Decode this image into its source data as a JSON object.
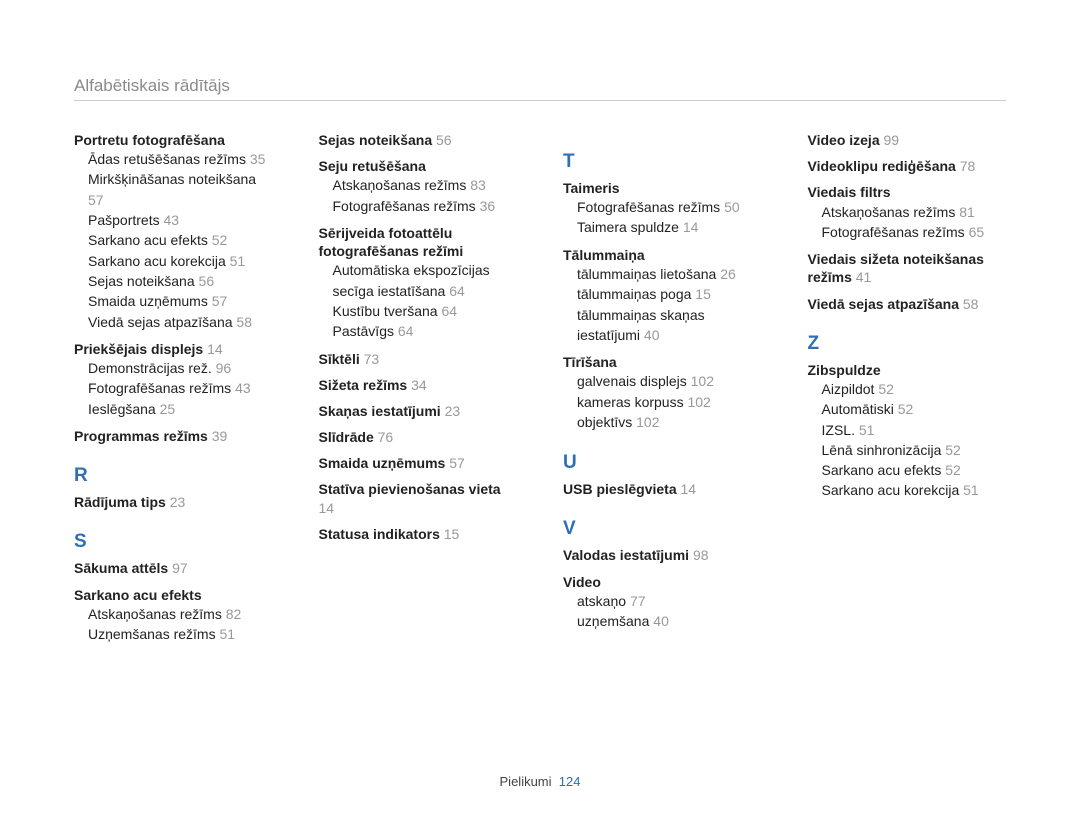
{
  "header": "Alfabētiskais rādītājs",
  "footer": {
    "label": "Pielikumi",
    "page": "124"
  },
  "columns": [
    [
      {
        "type": "entry",
        "title": "Portretu fotografēšana",
        "page": "",
        "subs": [
          {
            "t": "Ādas retušēšanas režīms",
            "p": "35"
          },
          {
            "t": "Mirkšķināšanas noteikšana",
            "p": "57"
          },
          {
            "t": "Pašportrets",
            "p": "43"
          },
          {
            "t": "Sarkano acu efekts",
            "p": "52"
          },
          {
            "t": "Sarkano acu korekcija",
            "p": "51"
          },
          {
            "t": "Sejas noteikšana",
            "p": "56"
          },
          {
            "t": "Smaida uzņēmums",
            "p": "57"
          },
          {
            "t": "Viedā sejas atpazīšana",
            "p": "58"
          }
        ]
      },
      {
        "type": "entry",
        "title": "Priekšējais displejs",
        "page": "14",
        "subs": [
          {
            "t": "Demonstrācijas rež.",
            "p": "96"
          },
          {
            "t": "Fotografēšanas režīms",
            "p": "43"
          },
          {
            "t": "Ieslēgšana",
            "p": "25"
          }
        ]
      },
      {
        "type": "entry",
        "title": "Programmas režīms",
        "page": "39",
        "subs": []
      },
      {
        "type": "letter",
        "label": "R"
      },
      {
        "type": "entry",
        "title": "Rādījuma tips",
        "page": "23",
        "subs": []
      },
      {
        "type": "letter",
        "label": "S"
      },
      {
        "type": "entry",
        "title": "Sākuma attēls",
        "page": "97",
        "subs": []
      },
      {
        "type": "entry",
        "title": "Sarkano acu efekts",
        "page": "",
        "subs": [
          {
            "t": "Atskaņošanas režīms",
            "p": "82"
          },
          {
            "t": "Uzņemšanas režīms",
            "p": "51"
          }
        ]
      }
    ],
    [
      {
        "type": "entry",
        "title": "Sejas noteikšana",
        "page": "56",
        "subs": []
      },
      {
        "type": "entry",
        "title": "Seju retušēšana",
        "page": "",
        "subs": [
          {
            "t": "Atskaņošanas režīms",
            "p": "83"
          },
          {
            "t": "Fotografēšanas režīms",
            "p": "36"
          }
        ]
      },
      {
        "type": "entry",
        "title": "Sērijveida fotoattēlu fotografēšanas režīmi",
        "page": "",
        "subs": [
          {
            "t": "Automātiska ekspozīcijas secīga iestatīšana",
            "p": "64"
          },
          {
            "t": "Kustību tveršana",
            "p": "64"
          },
          {
            "t": "Pastāvīgs",
            "p": "64"
          }
        ]
      },
      {
        "type": "entry",
        "title": "Sīktēli",
        "page": "73",
        "subs": []
      },
      {
        "type": "entry",
        "title": "Sižeta režīms",
        "page": "34",
        "subs": []
      },
      {
        "type": "entry",
        "title": "Skaņas iestatījumi",
        "page": "23",
        "subs": []
      },
      {
        "type": "entry",
        "title": "Slīdrāde",
        "page": "76",
        "subs": []
      },
      {
        "type": "entry",
        "title": "Smaida uzņēmums",
        "page": "57",
        "subs": []
      },
      {
        "type": "entry",
        "title": "Statīva pievienošanas vieta",
        "page": "14",
        "subs": []
      },
      {
        "type": "entry",
        "title": "Statusa indikators",
        "page": "15",
        "subs": []
      }
    ],
    [
      {
        "type": "letter",
        "label": "T"
      },
      {
        "type": "entry",
        "title": "Taimeris",
        "page": "",
        "subs": [
          {
            "t": "Fotografēšanas režīms",
            "p": "50"
          },
          {
            "t": "Taimera spuldze",
            "p": "14"
          }
        ]
      },
      {
        "type": "entry",
        "title": "Tālummaiņa",
        "page": "",
        "subs": [
          {
            "t": "tālummaiņas lietošana",
            "p": "26"
          },
          {
            "t": "tālummaiņas poga",
            "p": "15"
          },
          {
            "t": "tālummaiņas skaņas iestatījumi",
            "p": "40"
          }
        ]
      },
      {
        "type": "entry",
        "title": "Tīrīšana",
        "page": "",
        "subs": [
          {
            "t": "galvenais displejs",
            "p": "102"
          },
          {
            "t": "kameras korpuss",
            "p": "102"
          },
          {
            "t": "objektīvs",
            "p": "102"
          }
        ]
      },
      {
        "type": "letter",
        "label": "U"
      },
      {
        "type": "entry",
        "title": "USB pieslēgvieta",
        "page": "14",
        "subs": []
      },
      {
        "type": "letter",
        "label": "V"
      },
      {
        "type": "entry",
        "title": "Valodas iestatījumi",
        "page": "98",
        "subs": []
      },
      {
        "type": "entry",
        "title": "Video",
        "page": "",
        "subs": [
          {
            "t": "atskaņo",
            "p": "77"
          },
          {
            "t": "uzņemšana",
            "p": "40"
          }
        ]
      }
    ],
    [
      {
        "type": "entry",
        "title": "Video izeja",
        "page": "99",
        "subs": []
      },
      {
        "type": "entry",
        "title": "Videoklipu rediģēšana",
        "page": "78",
        "subs": []
      },
      {
        "type": "entry",
        "title": "Viedais filtrs",
        "page": "",
        "subs": [
          {
            "t": "Atskaņošanas režīms",
            "p": "81"
          },
          {
            "t": "Fotografēšanas režīms",
            "p": "65"
          }
        ]
      },
      {
        "type": "entry",
        "title": "Viedais sižeta noteikšanas režīms",
        "page": "41",
        "subs": []
      },
      {
        "type": "entry",
        "title": "Viedā sejas atpazīšana",
        "page": "58",
        "subs": []
      },
      {
        "type": "letter",
        "label": "Z"
      },
      {
        "type": "entry",
        "title": "Zibspuldze",
        "page": "",
        "subs": [
          {
            "t": "Aizpildot",
            "p": "52"
          },
          {
            "t": "Automātiski",
            "p": "52"
          },
          {
            "t": "IZSL.",
            "p": "51"
          },
          {
            "t": "Lēnā sinhronizācija",
            "p": "52"
          },
          {
            "t": "Sarkano acu efekts",
            "p": "52"
          },
          {
            "t": "Sarkano acu korekcija",
            "p": "51"
          }
        ]
      }
    ]
  ]
}
